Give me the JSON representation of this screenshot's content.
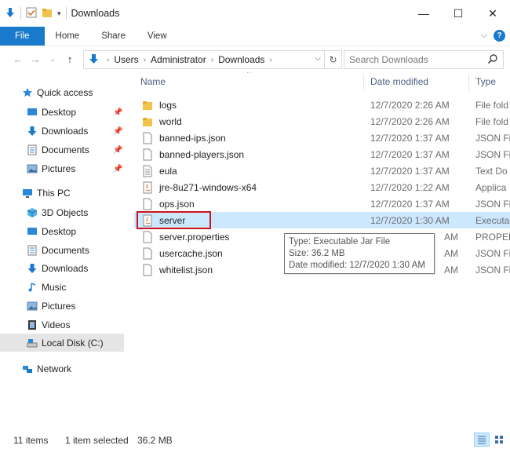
{
  "window": {
    "title": "Downloads",
    "minimize": "—",
    "maximize": "☐",
    "close": "✕"
  },
  "ribbon": {
    "tabs": [
      "File",
      "Home",
      "Share",
      "View"
    ],
    "help": "?"
  },
  "address": {
    "crumbs": [
      "Users",
      "Administrator",
      "Downloads"
    ],
    "search_placeholder": "Search Downloads"
  },
  "sidebar": {
    "quick_access": "Quick access",
    "quick_items": [
      "Desktop",
      "Downloads",
      "Documents",
      "Pictures"
    ],
    "this_pc": "This PC",
    "pc_items": [
      "3D Objects",
      "Desktop",
      "Documents",
      "Downloads",
      "Music",
      "Pictures",
      "Videos",
      "Local Disk (C:)"
    ],
    "network": "Network"
  },
  "columns": {
    "name": "Name",
    "date": "Date modified",
    "type": "Type"
  },
  "files": [
    {
      "name": "logs",
      "date": "12/7/2020 2:26 AM",
      "type": "File fold",
      "icon": "folder"
    },
    {
      "name": "world",
      "date": "12/7/2020 2:26 AM",
      "type": "File fold",
      "icon": "folder"
    },
    {
      "name": "banned-ips.json",
      "date": "12/7/2020 1:37 AM",
      "type": "JSON Fi",
      "icon": "file"
    },
    {
      "name": "banned-players.json",
      "date": "12/7/2020 1:37 AM",
      "type": "JSON Fi",
      "icon": "file"
    },
    {
      "name": "eula",
      "date": "12/7/2020 1:37 AM",
      "type": "Text Do",
      "icon": "text"
    },
    {
      "name": "jre-8u271-windows-x64",
      "date": "12/7/2020 1:22 AM",
      "type": "Applica",
      "icon": "java"
    },
    {
      "name": "ops.json",
      "date": "12/7/2020 1:37 AM",
      "type": "JSON Fi",
      "icon": "file"
    },
    {
      "name": "server",
      "date": "12/7/2020 1:30 AM",
      "type": "Executa",
      "icon": "java"
    },
    {
      "name": "server.properties",
      "date": "",
      "type": "PROPER",
      "icon": "file"
    },
    {
      "name": "usercache.json",
      "date": "",
      "type": "JSON Fi",
      "icon": "file"
    },
    {
      "name": "whitelist.json",
      "date": "",
      "type": "JSON Fi",
      "icon": "file"
    }
  ],
  "tooltip": {
    "type_line": "Type: Executable Jar File",
    "size_line": "Size: 36.2 MB",
    "date_line": "Date modified: 12/7/2020 1:30 AM",
    "obscured_date_tail": "AM"
  },
  "status": {
    "items": "11 items",
    "selected": "1 item selected",
    "size": "36.2 MB"
  },
  "colors": {
    "accent": "#1979ca",
    "selection": "#cce8ff",
    "highlight_box": "#d0121b"
  }
}
